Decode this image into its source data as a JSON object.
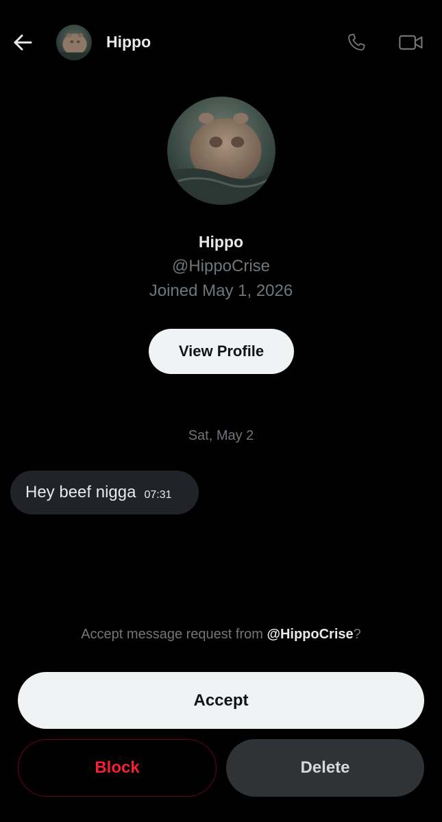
{
  "header": {
    "back_icon": "arrow-left-icon",
    "name": "Hippo",
    "call_icon": "phone-icon",
    "video_icon": "video-camera-icon"
  },
  "profile": {
    "name": "Hippo",
    "handle": "@HippoCrise",
    "joined": "Joined May 1, 2026",
    "view_profile_label": "View Profile"
  },
  "conversation": {
    "date_divider": "Sat, May 2",
    "messages": [
      {
        "text": "Hey beef nigga",
        "time": "07:31"
      }
    ]
  },
  "request": {
    "prompt_prefix": "Accept message request from ",
    "prompt_handle": "@HippoCrise",
    "prompt_suffix": "?",
    "accept_label": "Accept",
    "block_label": "Block",
    "delete_label": "Delete"
  },
  "colors": {
    "background": "#000000",
    "primary_text": "#e7e9ea",
    "secondary_text": "#71767b",
    "bubble": "#202327",
    "button_light": "#eff3f4",
    "block_red": "#f4212e",
    "delete_dark": "#2f3336"
  }
}
